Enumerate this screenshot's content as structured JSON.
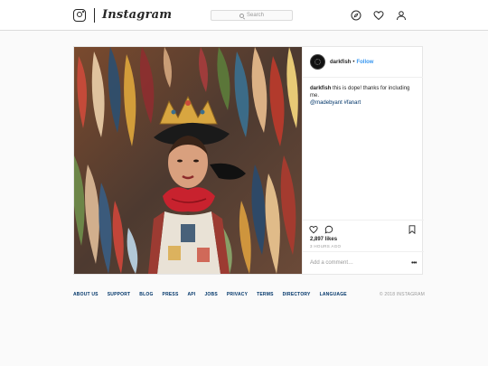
{
  "nav": {
    "logo_text": "Instagram",
    "search_placeholder": "Search"
  },
  "post": {
    "username": "darkfish",
    "follow_label": "Follow",
    "caption_user": "darkfish",
    "caption_text": "this is dope! thanks for including me.",
    "caption_mention": "@madebyant",
    "caption_tag": "#fanart",
    "likes": "2,897 likes",
    "time": "3 HOURS AGO",
    "add_comment_placeholder": "Add a comment…",
    "more_label": "•••"
  },
  "footer": {
    "links": [
      "ABOUT US",
      "SUPPORT",
      "BLOG",
      "PRESS",
      "API",
      "JOBS",
      "PRIVACY",
      "TERMS",
      "DIRECTORY",
      "LANGUAGE"
    ],
    "copyright": "© 2018 INSTAGRAM"
  },
  "colors": {
    "accent": "#3897f0",
    "link": "#003569",
    "border": "#dbdbdb"
  }
}
